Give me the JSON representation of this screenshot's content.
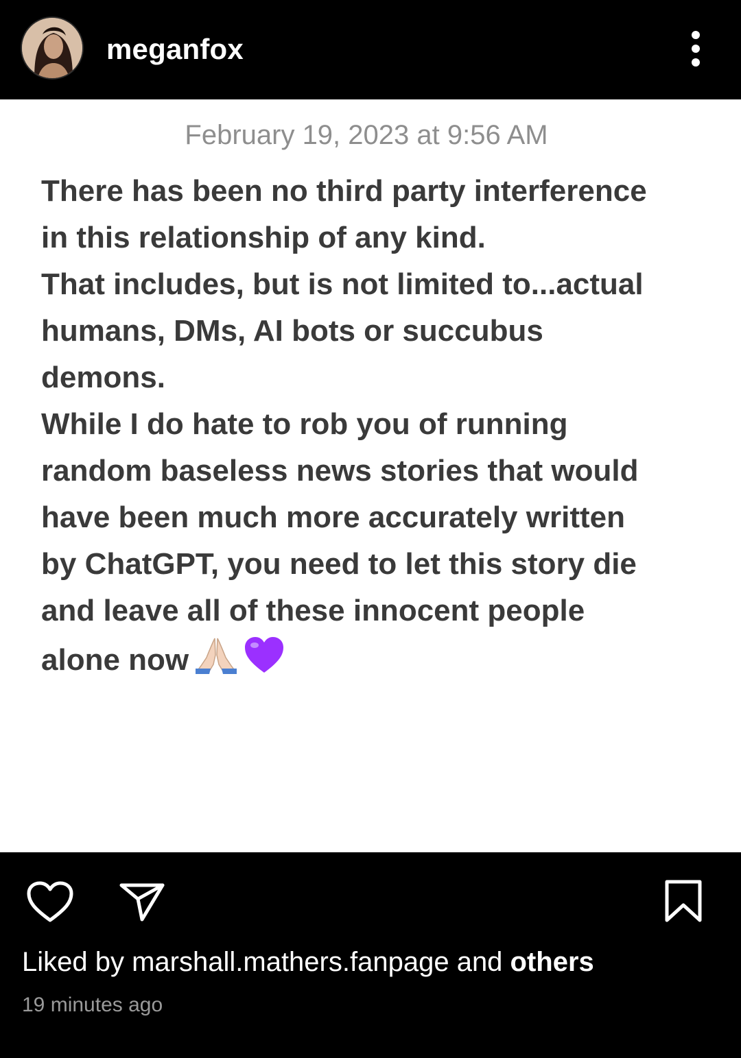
{
  "post": {
    "username": "meganfox",
    "timestamp": "February 19, 2023 at 9:56 AM",
    "note_lines": [
      "There has been no third party interference",
      "in this relationship of any kind.",
      "That includes, but is not limited to...actual",
      "humans, DMs, AI bots or succubus",
      "demons.",
      "While I do hate to rob you of running",
      "random baseless news stories that would",
      "have been much more accurately written",
      "by ChatGPT, you need to let this story die",
      "and leave all of these innocent people",
      "alone now"
    ],
    "emojis": [
      "🙏🏼",
      "💜"
    ]
  },
  "footer": {
    "liked_by_prefix": "Liked by ",
    "liked_by_user": "marshall.mathers.fanpage",
    "liked_by_joiner": " and ",
    "liked_by_others": "others",
    "time_ago": "19 minutes ago"
  },
  "icons": {
    "avatar": "profile-photo",
    "more": "vertical-ellipsis-icon",
    "like": "heart-icon",
    "share": "paper-plane-icon",
    "save": "bookmark-icon"
  },
  "colors": {
    "bar_background": "#000000",
    "card_background": "#ffffff",
    "body_text": "#3a3a3a",
    "timestamp_text": "#8e8e8e",
    "emoji_heart": "#9b30ff"
  }
}
